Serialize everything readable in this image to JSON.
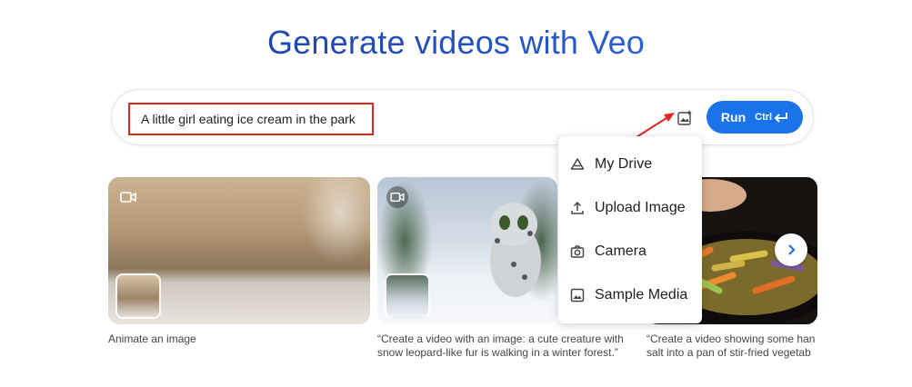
{
  "page": {
    "title": "Generate videos with Veo"
  },
  "prompt": {
    "value": "A little girl eating ice cream in the park",
    "add_image_icon": "add-image-icon",
    "run_label": "Run",
    "run_shortcut": "Ctrl"
  },
  "examples": [
    {
      "caption_lines": [
        "Animate an image"
      ],
      "badge_icon": "video-camera-icon"
    },
    {
      "caption_lines": [
        "“Create a video with an image: a cute creature with",
        "snow leopard-like fur is walking in a winter forest.”"
      ],
      "badge_icon": "video-camera-icon"
    },
    {
      "caption_lines": [
        "“Create a video showing some han",
        "salt into a pan of stir-fried vegetab"
      ]
    }
  ],
  "image_menu": {
    "items": [
      {
        "label": "My Drive",
        "icon": "drive-icon"
      },
      {
        "label": "Upload Image",
        "icon": "upload-icon"
      },
      {
        "label": "Camera",
        "icon": "camera-icon"
      },
      {
        "label": "Sample Media",
        "icon": "image-icon"
      }
    ]
  },
  "colors": {
    "accent": "#1a73e8",
    "annotation_red": "#e0261f",
    "title_blue": "#2352c8"
  }
}
